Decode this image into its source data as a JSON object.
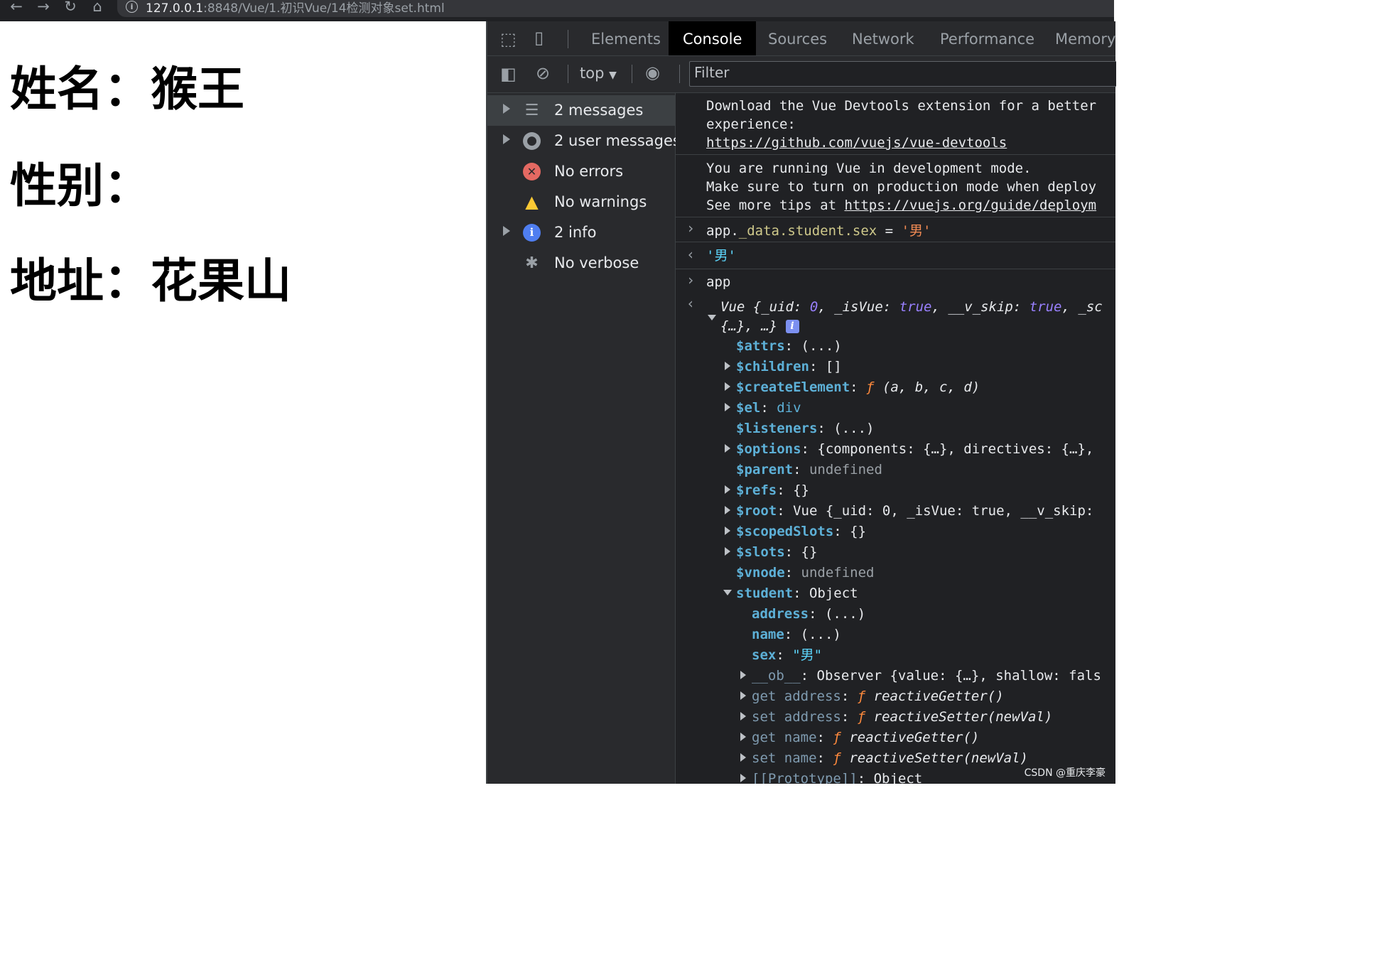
{
  "browser": {
    "url_host": "127.0.0.1",
    "url_rest": ":8848/Vue/1.初识Vue/14检测对象set.html"
  },
  "page": {
    "name_line": "姓名：猴王",
    "sex_line": "性别：",
    "address_line": "地址：花果山"
  },
  "devtools": {
    "tabs": [
      "Elements",
      "Console",
      "Sources",
      "Network",
      "Performance",
      "Memory"
    ],
    "active_tab": "Console",
    "context": "top",
    "filter_placeholder": "Filter",
    "sidebar": [
      {
        "label": "2 messages",
        "icon": "list-icon"
      },
      {
        "label": "2 user messages",
        "icon": "user-icon"
      },
      {
        "label": "No errors",
        "icon": "error-icon"
      },
      {
        "label": "No warnings",
        "icon": "warning-icon"
      },
      {
        "label": "2 info",
        "icon": "info-icon"
      },
      {
        "label": "No verbose",
        "icon": "bug-icon"
      }
    ],
    "console": {
      "devtools_msg_1": "Download the Vue Devtools extension for a better",
      "devtools_msg_2": "experience:",
      "devtools_link": "https://github.com/vuejs/vue-devtools",
      "devmode_1": "You are running Vue in development mode.",
      "devmode_2": "Make sure to turn on production mode when deploy",
      "devmode_3_prefix": "See more tips at ",
      "devmode_3_link": "https://vuejs.org/guide/deploym",
      "cmd_1_prefix": "app.",
      "cmd_1_path": "_data.student.sex",
      "cmd_1_eq": " = ",
      "cmd_1_val": "'男'",
      "result_1": "'男'",
      "cmd_2": "app",
      "vue_summary_1": "Vue {_uid: ",
      "vue_uid": "0",
      "vue_summary_2": ", _isVue: ",
      "vue_true": "true",
      "vue_summary_3": ", __v_skip: ",
      "vue_summary_4": ", _sc",
      "vue_summary_5": "{…}, …}",
      "badge": "i",
      "props": [
        {
          "key": "$attrs",
          "val": "(...)"
        },
        {
          "key": "$children",
          "val": "[]"
        },
        {
          "key": "$createElement",
          "val": "(a, b, c, d)"
        },
        {
          "key": "$el",
          "val": "div"
        },
        {
          "key": "$listeners",
          "val": "(...)"
        },
        {
          "key": "$options",
          "val": "{components: {…}, directives: {…},"
        },
        {
          "key": "$parent",
          "val": "undefined"
        },
        {
          "key": "$refs",
          "val": "{}"
        },
        {
          "key": "$root",
          "val": "Vue {_uid: 0, _isVue: true, __v_skip:"
        },
        {
          "key": "$scopedSlots",
          "val": "{}"
        },
        {
          "key": "$slots",
          "val": "{}"
        },
        {
          "key": "$vnode",
          "val": "undefined"
        },
        {
          "key": "student",
          "val": "Object"
        },
        {
          "key": "address",
          "val": "(...)"
        },
        {
          "key": "name",
          "val": "(...)"
        },
        {
          "key": "sex",
          "val": "\"男\""
        },
        {
          "key": "__ob__",
          "val": "Observer {value: {…}, shallow: fals"
        },
        {
          "key": "get address",
          "val": "reactiveGetter()"
        },
        {
          "key": "set address",
          "val": "reactiveSetter(newVal)"
        },
        {
          "key": "get name",
          "val": "reactiveGetter()"
        },
        {
          "key": "set name",
          "val": "reactiveSetter(newVal)"
        },
        {
          "key": "[[Prototype]]",
          "val": "Object"
        }
      ],
      "fn_glyph": "ƒ"
    }
  },
  "watermark": "CSDN @重庆李豪"
}
